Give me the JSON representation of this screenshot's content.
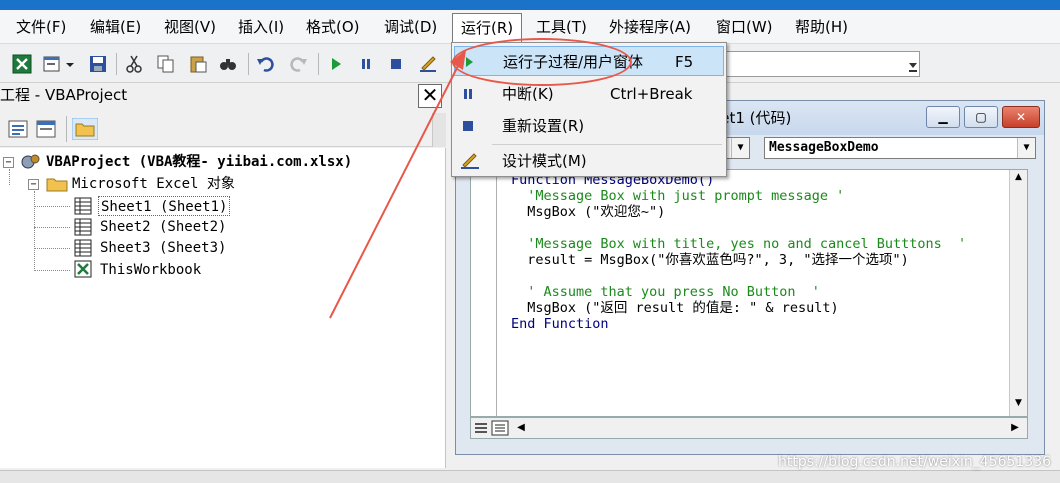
{
  "menubar": {
    "items": [
      {
        "label": "文件(F)"
      },
      {
        "label": "编辑(E)"
      },
      {
        "label": "视图(V)"
      },
      {
        "label": "插入(I)"
      },
      {
        "label": "格式(O)"
      },
      {
        "label": "调试(D)"
      },
      {
        "label": "运行(R)"
      },
      {
        "label": "工具(T)"
      },
      {
        "label": "外接程序(A)"
      },
      {
        "label": "窗口(W)"
      },
      {
        "label": "帮助(H)"
      }
    ]
  },
  "run_menu": {
    "items": [
      {
        "label": "运行子过程/用户窗体",
        "shortcut": "F5",
        "icon": "play-icon"
      },
      {
        "label": "中断(K)",
        "shortcut": "Ctrl+Break",
        "icon": "pause-icon"
      },
      {
        "label": "重新设置(R)",
        "shortcut": "",
        "icon": "stop-icon"
      },
      {
        "label": "设计模式(M)",
        "shortcut": "",
        "icon": "design-mode-icon"
      }
    ]
  },
  "project": {
    "title": "工程 - VBAProject",
    "close": "✕",
    "tree": {
      "root": "VBAProject (VBA教程-  yiibai.com.xlsx)",
      "folder": "Microsoft Excel 对象",
      "items": [
        "Sheet1 (Sheet1)",
        "Sheet2 (Sheet2)",
        "Sheet3 (Sheet3)",
        "ThisWorkbook"
      ]
    }
  },
  "code_window": {
    "title": "eet1 (代码)",
    "object_combo": "",
    "proc_combo": "MessageBoxDemo",
    "lines": [
      {
        "text": "Function MessageBoxDemo()",
        "color": "blue"
      },
      {
        "text": "  'Message Box with just prompt message '",
        "color": "green"
      },
      {
        "text": "  MsgBox (\"欢迎您~\")",
        "color": "black"
      },
      {
        "text": "",
        "color": "black"
      },
      {
        "text": "  'Message Box with title, yes no and cancel Butttons  '",
        "color": "green"
      },
      {
        "text": "  result = MsgBox(\"你喜欢蓝色吗?\", 3, \"选择一个选项\")",
        "color": "black"
      },
      {
        "text": "",
        "color": "black"
      },
      {
        "text": "  ' Assume that you press No Button  '",
        "color": "green"
      },
      {
        "text": "  MsgBox (\"返回 result 的值是: \" & result)",
        "color": "black"
      },
      {
        "text": "End Function",
        "color": "blue"
      }
    ]
  },
  "watermark": "https://blog.csdn.net/weixin_45651336",
  "colors": {
    "accent": "#1a73c8",
    "highlight": "#cce4f7",
    "annotation": "#e8584a"
  }
}
